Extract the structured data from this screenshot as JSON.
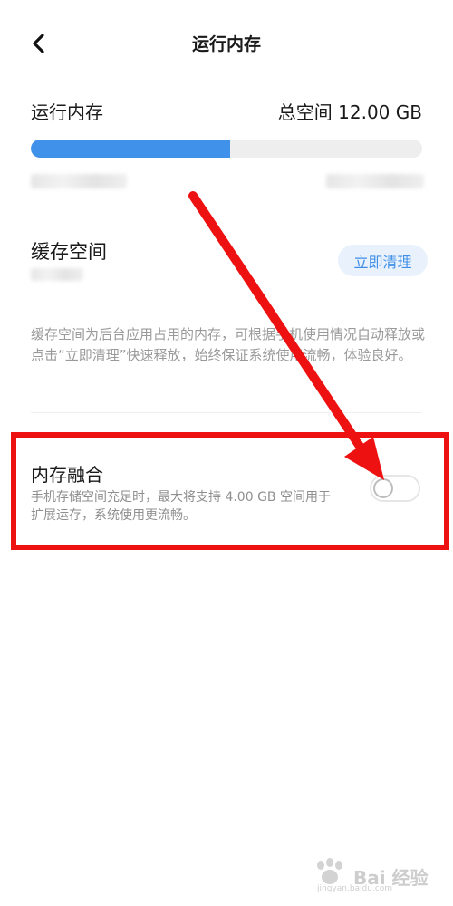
{
  "header": {
    "title": "运行内存",
    "back_icon": "chevron-left-icon"
  },
  "memory": {
    "title": "运行内存",
    "total_label": "总空间 12.00 GB",
    "usage_fraction": 0.51,
    "accent_color": "#3f91ea"
  },
  "cache": {
    "title": "缓存空间",
    "clean_button_label": "立即清理",
    "description": "缓存空间为后台应用占用的内存，可根据手机使用情况自动释放或点击“立即清理”快速释放，始终保证系统使用流畅，体验良好。"
  },
  "memory_fusion": {
    "title": "内存融合",
    "description": "手机存储空间充足时，最大将支持 4.00 GB 空间用于扩展运存，系统使用更流畅。",
    "enabled": false
  },
  "annotation": {
    "highlight_color": "#ee1111"
  },
  "watermark": {
    "text": "Bai 经验",
    "sub_text": "jingyan.baidu.com"
  }
}
